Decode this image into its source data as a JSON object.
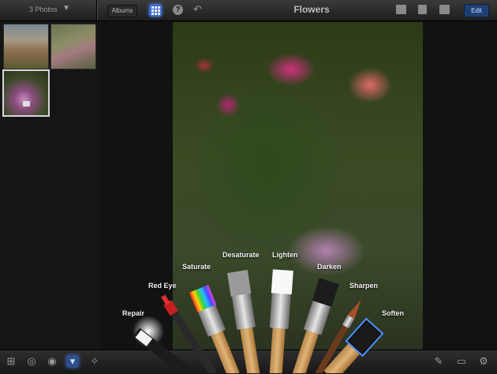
{
  "toolbar": {
    "photo_count": "3 Photos",
    "albums_label": "Albums",
    "help_glyph": "?",
    "title": "Flowers",
    "edit_label": "Edit"
  },
  "icons": {
    "dropdown": "chevron-down-icon",
    "grid": "grid-icon",
    "help": "help-icon",
    "undo": "undo-icon",
    "share": "share-icon",
    "info": "info-icon",
    "compare": "compare-icon",
    "crop": "crop-icon",
    "exposure": "exposure-icon",
    "color": "color-palette-icon",
    "brushes": "brushes-icon",
    "effects": "effects-icon",
    "brush_paint": "paint-brush-icon",
    "eraser": "eraser-icon",
    "settings": "gear-icon"
  },
  "brushes": [
    {
      "label": "Repair"
    },
    {
      "label": "Red Eye"
    },
    {
      "label": "Saturate"
    },
    {
      "label": "Desaturate"
    },
    {
      "label": "Lighten"
    },
    {
      "label": "Darken"
    },
    {
      "label": "Sharpen"
    },
    {
      "label": "Soften"
    }
  ],
  "colors": {
    "accent": "#3d6ec9",
    "selected_brush_glow": "#4a90ff"
  }
}
